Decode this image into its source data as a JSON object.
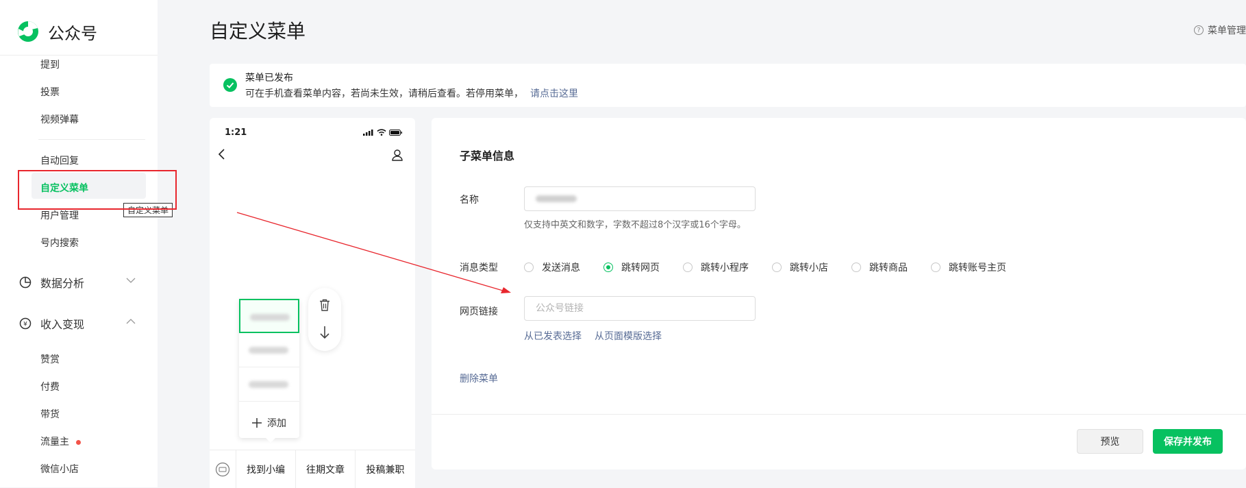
{
  "brand": {
    "name": "公众号"
  },
  "sidebar": {
    "items_top": [
      {
        "label": "提到"
      },
      {
        "label": "投票"
      },
      {
        "label": "视频弹幕"
      }
    ],
    "items_mid": [
      {
        "label": "自动回复"
      },
      {
        "label": "自定义菜单",
        "active": true
      },
      {
        "label": "用户管理"
      },
      {
        "label": "号内搜索"
      }
    ],
    "groups": [
      {
        "label": "数据分析",
        "expanded": false
      },
      {
        "label": "收入变现",
        "expanded": true
      }
    ],
    "items_bottom": [
      {
        "label": "赞赏"
      },
      {
        "label": "付费"
      },
      {
        "label": "带货"
      },
      {
        "label": "流量主",
        "badge_dot": true
      },
      {
        "label": "微信小店"
      }
    ],
    "tooltip": "自定义菜单"
  },
  "header": {
    "title": "自定义菜单",
    "help_link": "菜单管理"
  },
  "notice": {
    "title": "菜单已发布",
    "desc": "可在手机查看菜单内容，若尚未生效，请稍后查看。若停用菜单，",
    "link": "请点击这里"
  },
  "phone": {
    "time": "1:21",
    "submenu_add": "添加",
    "bottom_menu": [
      "找到小编",
      "往期文章",
      "投稿兼职"
    ]
  },
  "form": {
    "section_title": "子菜单信息",
    "name_label": "名称",
    "name_hint": "仅支持中英文和数字，字数不超过8个汉字或16个字母。",
    "type_label": "消息类型",
    "types": [
      {
        "label": "发送消息",
        "checked": false
      },
      {
        "label": "跳转网页",
        "checked": true
      },
      {
        "label": "跳转小程序",
        "checked": false
      },
      {
        "label": "跳转小店",
        "checked": false
      },
      {
        "label": "跳转商品",
        "checked": false
      },
      {
        "label": "跳转账号主页",
        "checked": false
      }
    ],
    "url_label": "网页链接",
    "url_placeholder": "公众号链接",
    "select_published": "从已发表选择",
    "select_template": "从页面模版选择",
    "delete_menu": "删除菜单",
    "preview_btn": "预览",
    "publish_btn": "保存并发布"
  },
  "colors": {
    "brand_green": "#07c160",
    "link_blue": "#576b95",
    "annotation_red": "#e8262d"
  }
}
